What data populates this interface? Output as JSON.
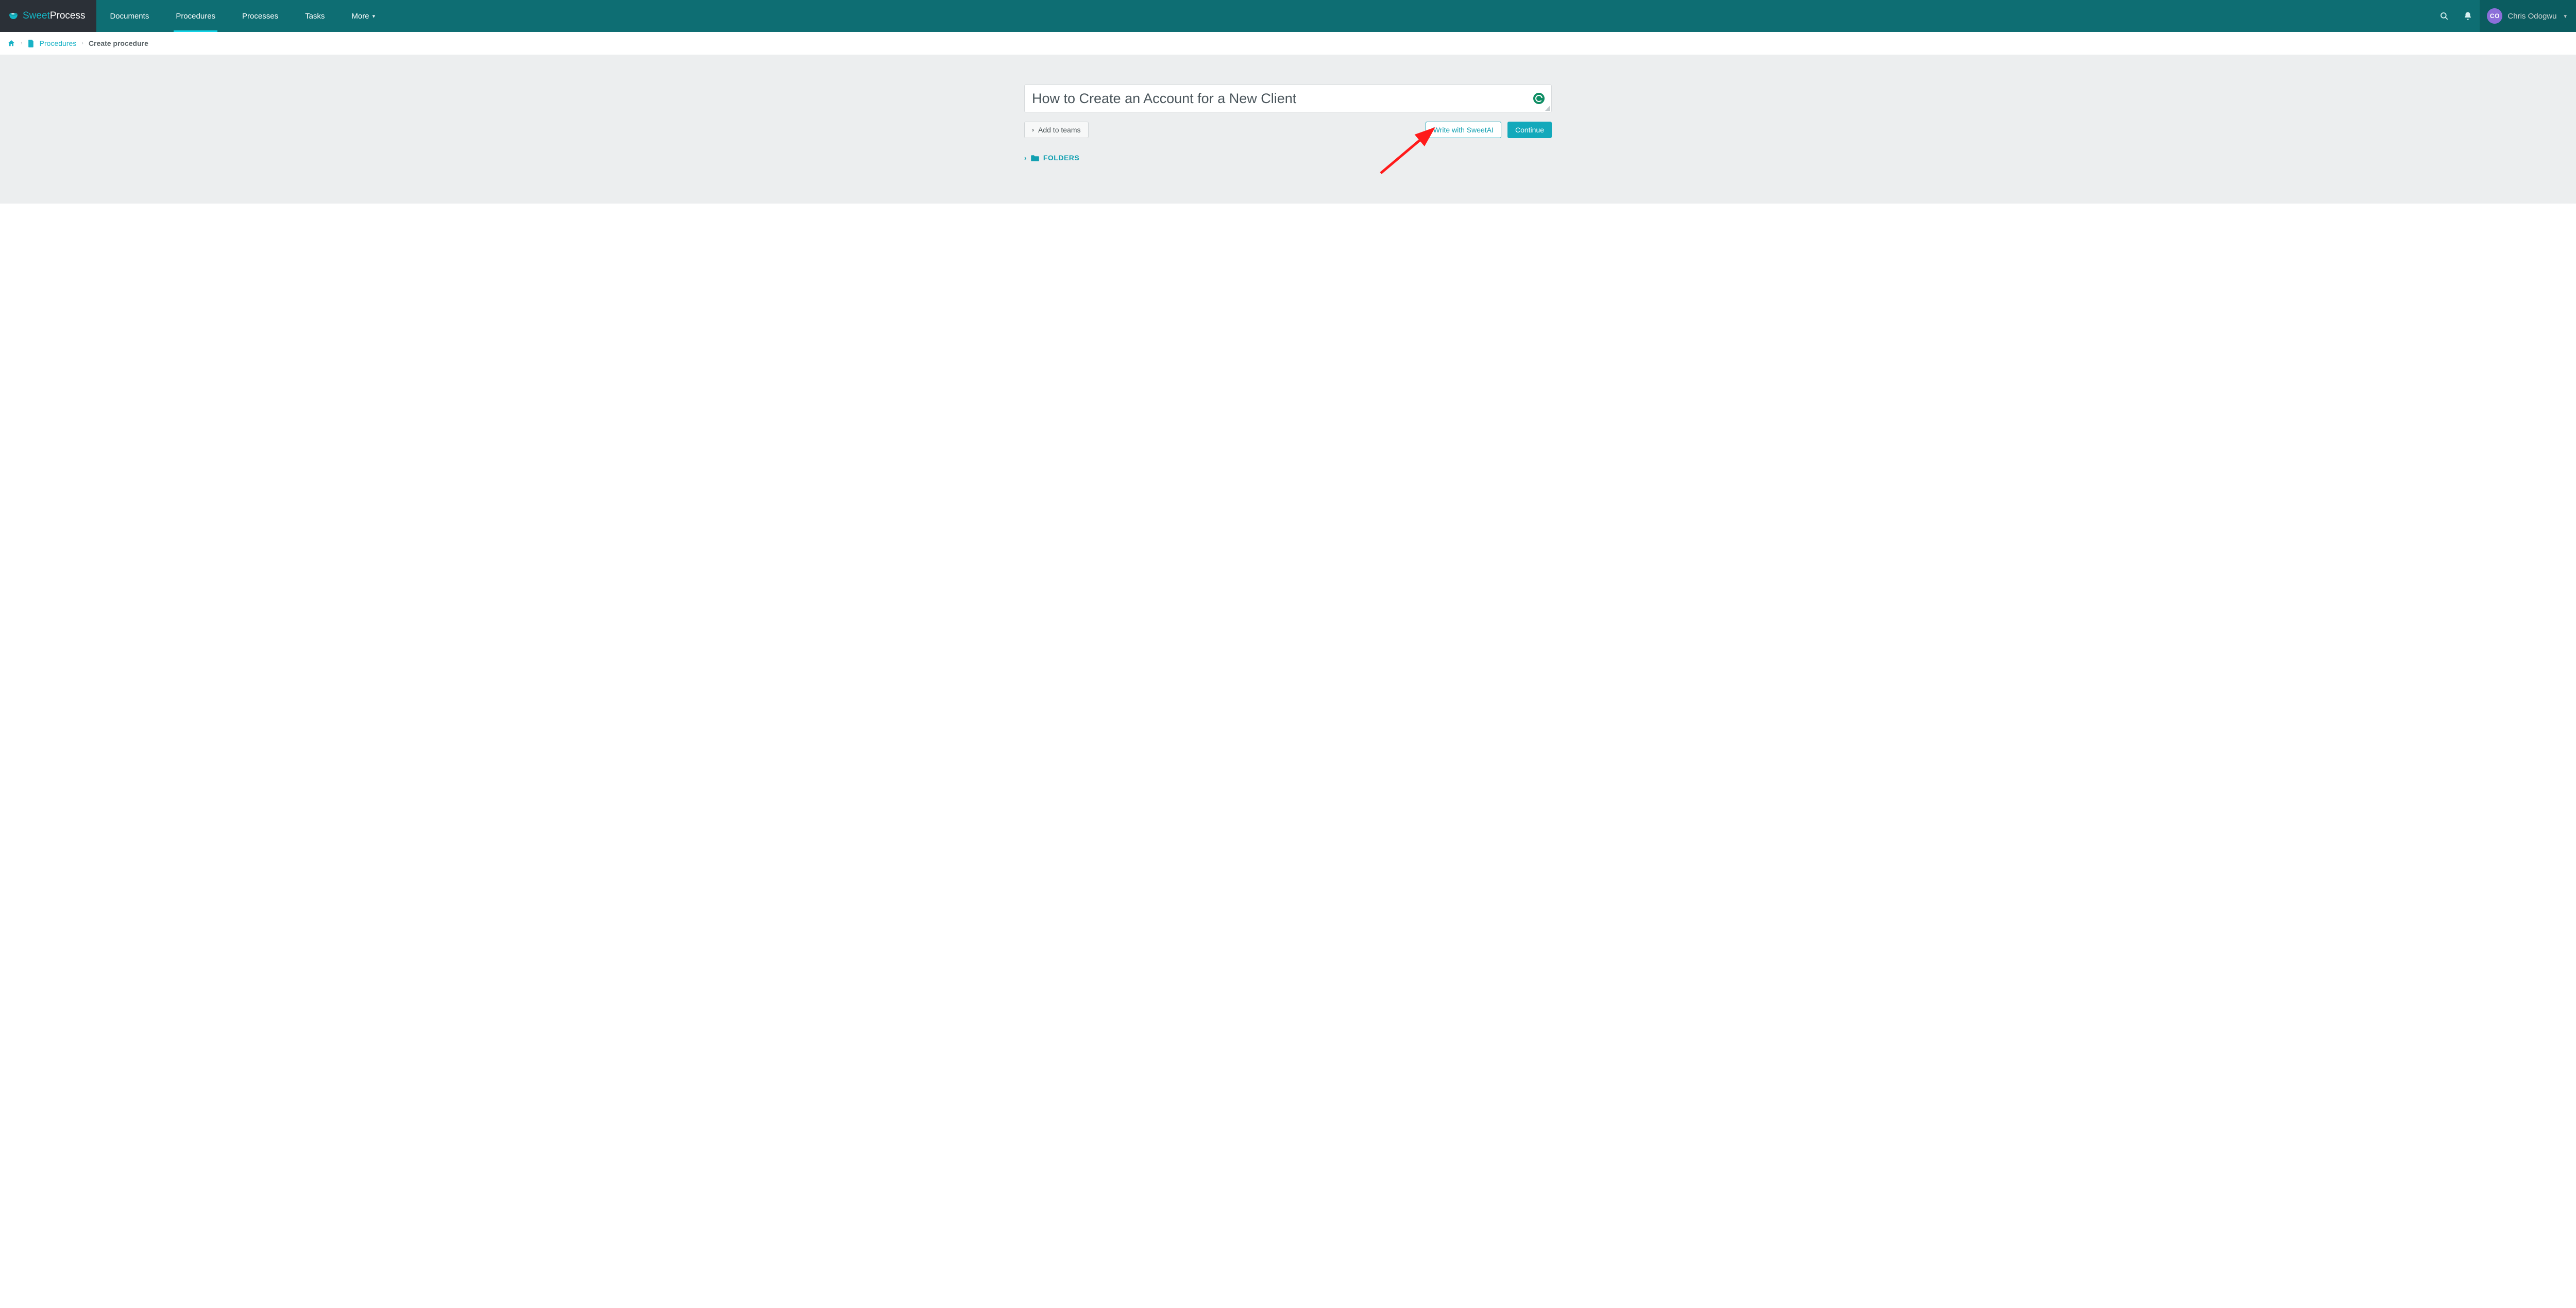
{
  "brand": {
    "part1": "Sweet",
    "part2": "Process"
  },
  "nav": {
    "documents": "Documents",
    "procedures": "Procedures",
    "processes": "Processes",
    "tasks": "Tasks",
    "more": "More"
  },
  "user": {
    "initials": "CO",
    "name": "Chris Odogwu"
  },
  "breadcrumb": {
    "procedures": "Procedures",
    "current": "Create procedure"
  },
  "form": {
    "title_value": "How to Create an Account for a New Client",
    "add_to_teams": "Add to teams",
    "write_ai": "Write with SweetAI",
    "continue": "Continue",
    "folders": "FOLDERS"
  }
}
